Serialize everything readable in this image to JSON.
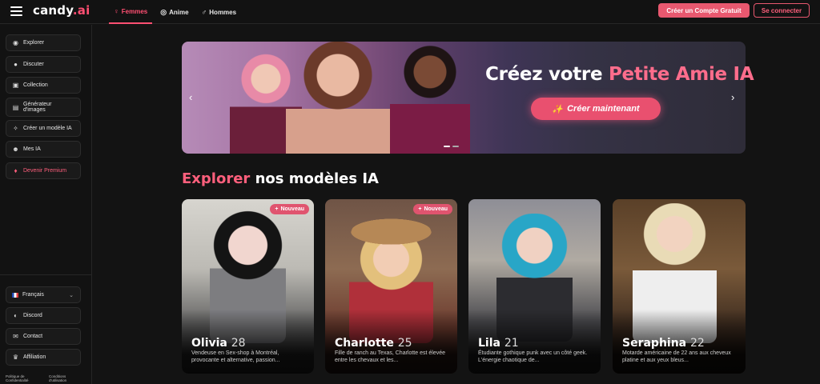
{
  "header": {
    "logo_main": "candy",
    "logo_accent": ".ai",
    "tabs": [
      {
        "label": "Femmes",
        "icon": "female-icon",
        "active": true
      },
      {
        "label": "Anime",
        "icon": "anime-icon",
        "active": false
      },
      {
        "label": "Hommes",
        "icon": "male-icon",
        "active": false
      }
    ],
    "signup_label": "Créer un Compte Gratuit",
    "login_label": "Se connecter"
  },
  "sidebar": {
    "items": [
      {
        "label": "Explorer",
        "icon": "compass-icon"
      },
      {
        "label": "Discuter",
        "icon": "chat-icon"
      },
      {
        "label": "Collection",
        "icon": "collection-icon"
      },
      {
        "label": "Générateur d'images",
        "icon": "image-generator-icon"
      },
      {
        "label": "Créer un modèle IA",
        "icon": "magic-wand-icon"
      },
      {
        "label": "Mes IA",
        "icon": "my-ai-icon"
      },
      {
        "label": "Devenir Premium",
        "icon": "diamond-icon"
      }
    ],
    "language": "Français",
    "bottom_items": [
      {
        "label": "Discord",
        "icon": "discord-icon"
      },
      {
        "label": "Contact",
        "icon": "contact-icon"
      },
      {
        "label": "Affiliation",
        "icon": "trophy-icon"
      }
    ],
    "footer_links": [
      "Politique de Confidentialité",
      "Conditions d'utilisation"
    ]
  },
  "hero": {
    "title_prefix": "Créez votre",
    "title_highlight": "Petite Amie IA",
    "cta_label": "Créer maintenant"
  },
  "section": {
    "title_highlight": "Explorer",
    "title_rest": "nos modèles IA"
  },
  "cards": [
    {
      "name": "Olivia",
      "age": "28",
      "badge": "Nouveau",
      "description": "Vendeuse en Sex-shop à Montréal, provocante et alternative, passion..."
    },
    {
      "name": "Charlotte",
      "age": "25",
      "badge": "Nouveau",
      "description": "Fille de ranch au Texas, Charlotte est élevée entre les chevaux et les..."
    },
    {
      "name": "Lila",
      "age": "21",
      "badge": "",
      "description": "Étudiante gothique punk avec un côté geek. L'énergie chaotique de..."
    },
    {
      "name": "Seraphina",
      "age": "22",
      "badge": "",
      "description": "Motarde américaine de 22 ans aux cheveux platine et aux yeux bleus..."
    }
  ],
  "colors": {
    "accent": "#ff4f72",
    "button": "#e8586f",
    "background": "#131313"
  }
}
